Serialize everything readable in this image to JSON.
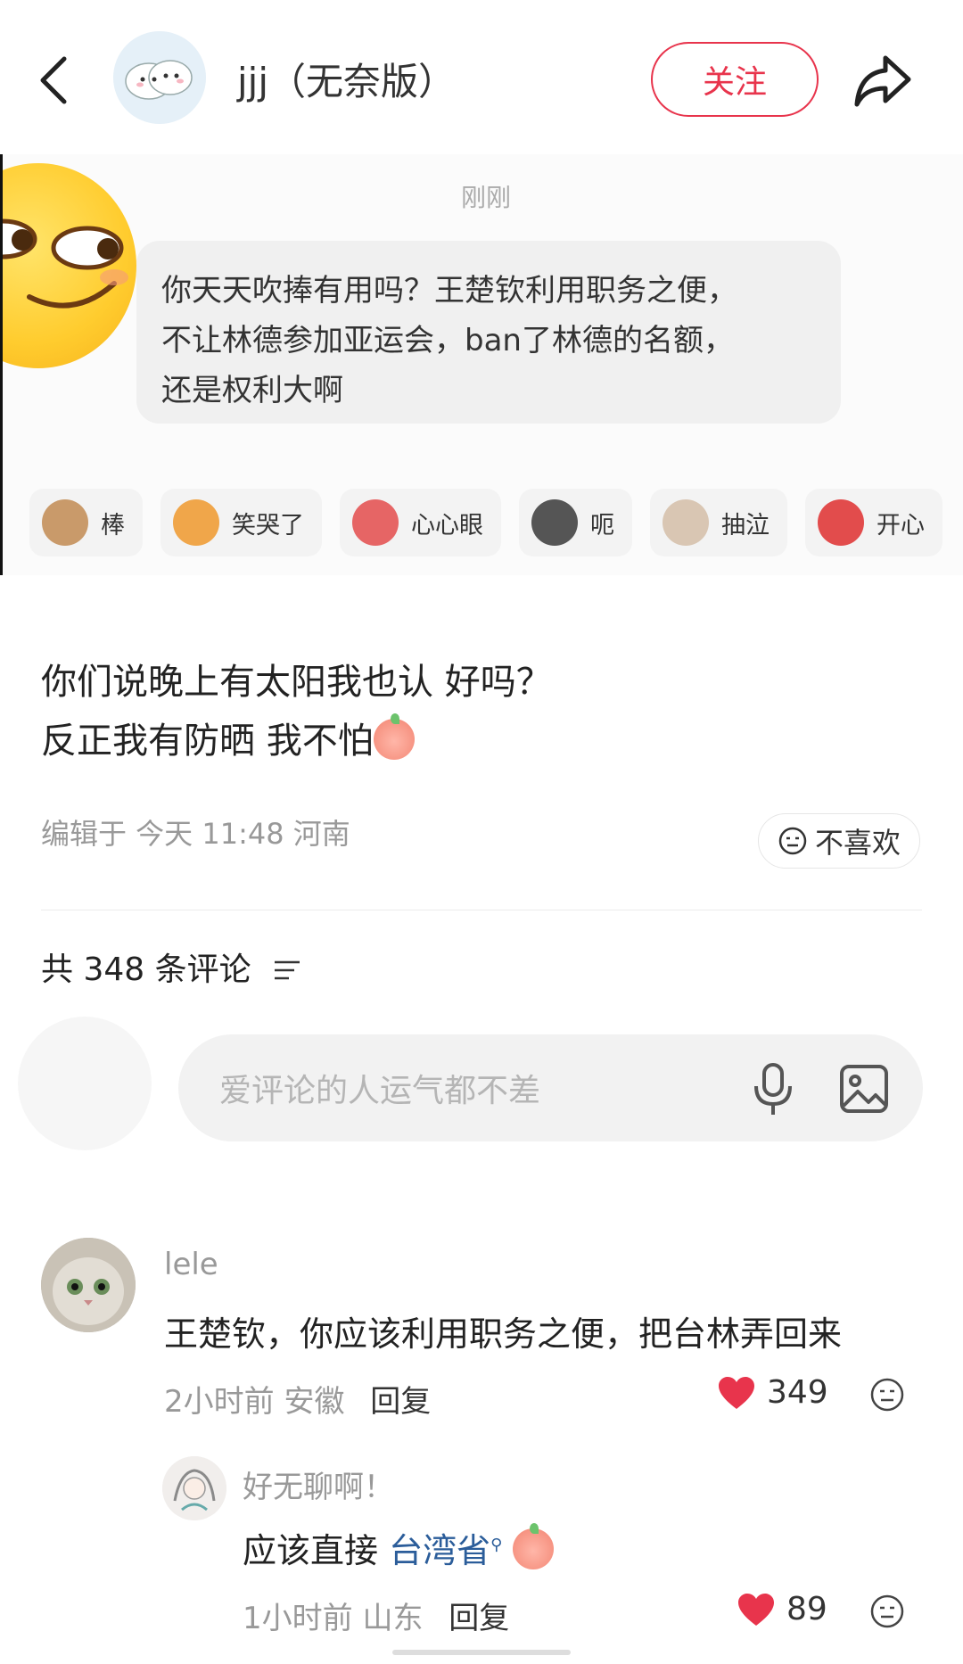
{
  "header": {
    "username": "jjj（无奈版）",
    "follow_label": "关注"
  },
  "embed": {
    "time_label": "刚刚",
    "message_lines": [
      "你天天吹捧有用吗？王楚钦利用职务之便，",
      "不让林德参加亚运会，ban了林德的名额，",
      "还是权利大啊"
    ],
    "reactions": [
      {
        "label": "棒",
        "color": "#c99a6a"
      },
      {
        "label": "笑哭了",
        "color": "#f0a64a"
      },
      {
        "label": "心心眼",
        "color": "#e66565"
      },
      {
        "label": "呃",
        "color": "#555555"
      },
      {
        "label": "抽泣",
        "color": "#d9c6b3"
      },
      {
        "label": "开心",
        "color": "#e24c4c"
      }
    ]
  },
  "post": {
    "line1": "你们说晚上有太阳我也认 好吗？",
    "line2": "反正我有防晒 我不怕",
    "meta": "编辑于 今天 11:48 河南",
    "dislike_label": "不喜欢",
    "comment_count": "共 348 条评论"
  },
  "comment_input": {
    "placeholder": "爱评论的人运气都不差"
  },
  "comments": [
    {
      "name": "lele",
      "text": "王楚钦，你应该利用职务之便，把台林弄回来",
      "time": "2小时前",
      "location": "安徽",
      "reply_label": "回复",
      "likes": "349"
    },
    {
      "name": "好无聊啊！",
      "text_prefix": "应该直接 ",
      "text_link": "台湾省",
      "time": "1小时前",
      "location": "山东",
      "reply_label": "回复",
      "likes": "89"
    }
  ],
  "colors": {
    "accent": "#e8344c",
    "link": "#2b5d9a"
  }
}
